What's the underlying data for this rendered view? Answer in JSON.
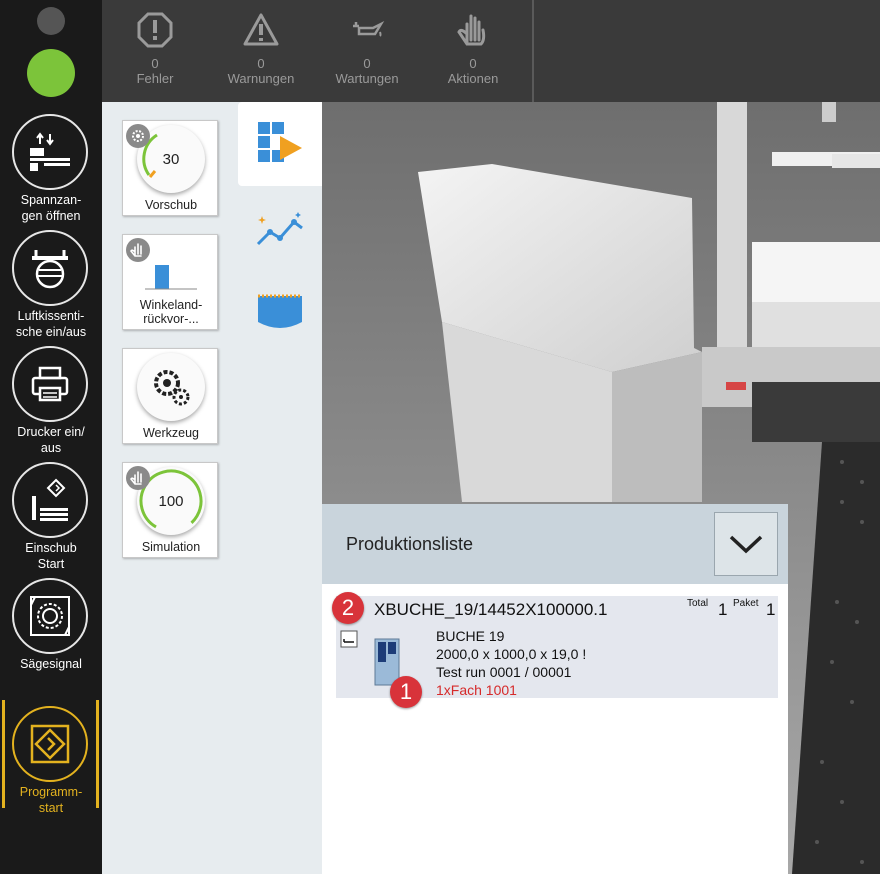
{
  "status_bar": [
    {
      "icon": "error-octagon-icon",
      "count": "0",
      "label": "Fehler"
    },
    {
      "icon": "warning-triangle-icon",
      "count": "0",
      "label": "Warnungen"
    },
    {
      "icon": "oil-can-icon",
      "count": "0",
      "label": "Wartungen"
    },
    {
      "icon": "hand-stop-icon",
      "count": "0",
      "label": "Aktionen"
    }
  ],
  "sidebar": {
    "items": [
      {
        "label": "Spannzan-\ngen öffnen",
        "icon": "clamp-open-icon"
      },
      {
        "label": "Luftkissenti-\nsche ein/aus",
        "icon": "air-table-icon"
      },
      {
        "label": "Drucker ein/\naus",
        "icon": "printer-icon"
      },
      {
        "label": "Einschub\nStart",
        "icon": "pusher-start-icon"
      },
      {
        "label": "Sägesignal",
        "icon": "saw-signal-icon"
      },
      {
        "label": "Programm-\nstart",
        "icon": "program-start-icon",
        "active": true
      }
    ],
    "active_color": "#e3b21f",
    "status_color": "#7cc43a"
  },
  "tools": [
    {
      "label": "Vorschub",
      "value": "30",
      "badge": "gear-icon"
    },
    {
      "label": "Winkeland-\nrückvor-...",
      "value": "",
      "badge": "hand-icon"
    },
    {
      "label": "Werkzeug",
      "value": "",
      "badge": ""
    },
    {
      "label": "Simulation",
      "value": "100",
      "badge": "hand-icon"
    }
  ],
  "view_tabs": [
    {
      "icon": "cutting-plan-play-icon",
      "selected": true
    },
    {
      "icon": "chart-sparkle-icon",
      "selected": false
    },
    {
      "icon": "panel-view-icon",
      "selected": false
    }
  ],
  "production_list": {
    "title": "Produktionsliste",
    "items": [
      {
        "code": "XBUCHE_19/14452X100000.1",
        "total_label": "Total",
        "total_value": "1",
        "paket_label": "Paket",
        "paket_value": "1",
        "material": "BUCHE  19",
        "dimensions": "2000,0 x 1000,0 x 19,0 !",
        "run": "Test run  0001 / 00001",
        "compartment": "1xFach 1001"
      }
    ]
  },
  "callouts": [
    "1",
    "2"
  ]
}
